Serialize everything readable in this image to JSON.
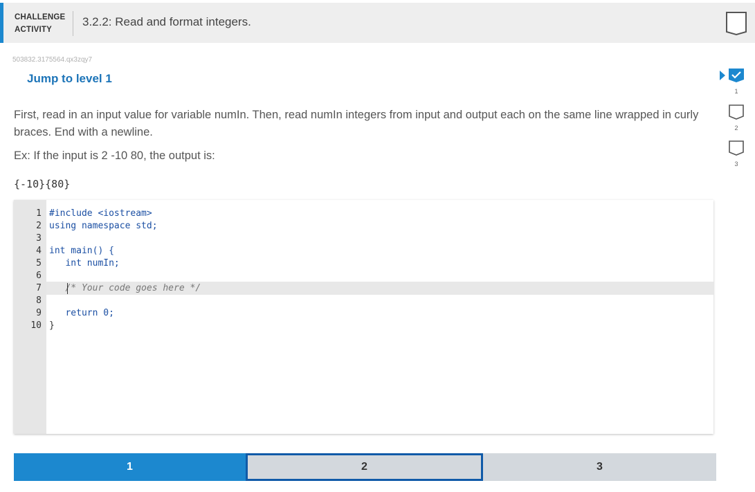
{
  "header": {
    "kicker": "CHALLENGE ACTIVITY",
    "title": "3.2.2: Read and format integers."
  },
  "activity_id": "503832.3175564.qx3zqy7",
  "jump_link": "Jump to level 1",
  "description": "First, read in an input value for variable numIn. Then, read numIn integers from input and output each on the same line wrapped in curly braces. End with a newline.",
  "example_text": "Ex: If the input is 2 -10 80, the output is:",
  "example_output": "{-10}{80}",
  "code": {
    "line_numbers": [
      "1",
      "2",
      "3",
      "4",
      "5",
      "6",
      "7",
      "8",
      "9",
      "10"
    ],
    "lines": [
      "#include <iostream>",
      "using namespace std;",
      "",
      "int main() {",
      "   int numIn;",
      "",
      "   /* Your code goes here */",
      "",
      "   return 0;",
      "}"
    ]
  },
  "levels": {
    "bar": [
      "1",
      "2",
      "3"
    ],
    "side": [
      "1",
      "2",
      "3"
    ],
    "current": 2,
    "completed": [
      1
    ]
  },
  "colors": {
    "accent": "#1c88cf",
    "link": "#1c74b8",
    "active_border": "#0f5aa8"
  },
  "icons": {
    "header_box": "empty-square-icon",
    "level_done": "checkmark-icon",
    "level_pending": "empty-square-icon",
    "current_marker": "triangle-arrow-icon"
  }
}
